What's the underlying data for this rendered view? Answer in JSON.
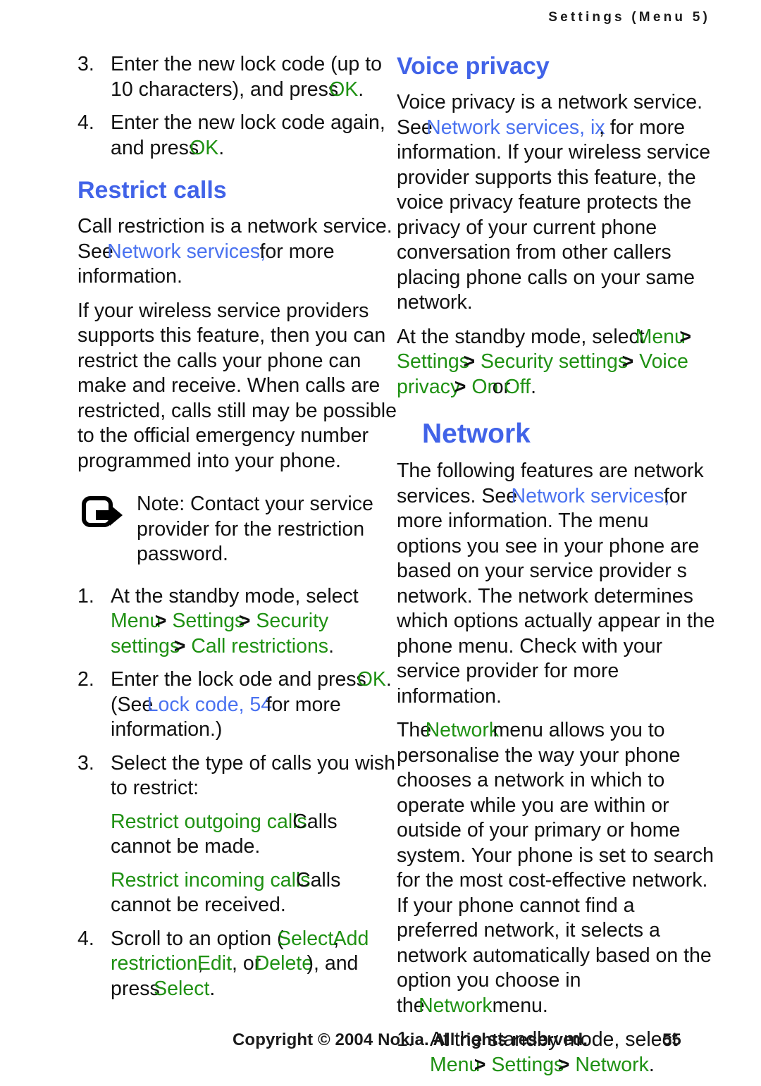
{
  "header": {
    "running_title": "Settings (Menu 5)"
  },
  "colors": {
    "heading_blue": "#4163e8",
    "link_blue": "#4a72f0",
    "ui_green": "#1f9113",
    "body_black": "#111111"
  },
  "left_column": {
    "steps_top": [
      {
        "num": "3.",
        "text_a": "Enter the new lock code (up to 10 characters), and press",
        "ui": "OK",
        "text_b": "."
      },
      {
        "num": "4.",
        "text_a": "Enter the new lock code again, and press",
        "ui": "OK",
        "text_b": "."
      }
    ],
    "heading": "Restrict calls",
    "para_1_a": "Call restriction is a network service. See",
    "para_1_link": "Network services,",
    "para_1_b": "for more information.",
    "para_2": "If your wireless service providers supports this feature, then you can restrict the calls your phone can make and receive. When calls are restricted, calls still may be possible to the official emergency number programmed into your phone.",
    "note": {
      "icon": "note-arrow-icon",
      "label": "Note:",
      "text": "Contact your service provider for the restriction password."
    },
    "steps": [
      {
        "num": "1.",
        "text_a": "At the standby mode, select",
        "menu_path": [
          "Menu",
          "Settings",
          "Security settings",
          "Call restrictions"
        ],
        "separator": ">",
        "text_b": "."
      },
      {
        "num": "2.",
        "text_a": "Enter the lock ode and press",
        "ui": "OK",
        "text_b": ". (See",
        "link": "Lock code, 54",
        "text_c": "for more information.)"
      },
      {
        "num": "3.",
        "text_a": "Select the type of calls you wish to restrict:"
      }
    ],
    "definitions": [
      {
        "term": "Restrict outgoing calls",
        "desc": "Calls cannot be made."
      },
      {
        "term": "Restrict incoming calls",
        "desc": "Calls cannot be received."
      }
    ],
    "step_4": {
      "num": "4.",
      "text_a": "Scroll to an option (",
      "ui_1": "Select",
      "text_b": ",",
      "ui_2": "Add restriction",
      "text_c": ",",
      "ui_3": "Edit",
      "text_d": ", or",
      "ui_4": "Delete",
      "text_e": "), and press",
      "ui_5": "Select",
      "text_f": "."
    }
  },
  "right_column": {
    "heading_voice": "Voice privacy",
    "voice_para_a": "Voice privacy is a network service. See",
    "voice_link": "Network services, ix",
    "voice_para_b": ", for more information. If your wireless service provider supports this feature, the voice privacy feature protects the privacy of your current phone conversation from other callers placing phone calls on your same network.",
    "voice_step_a": "At the standby mode, select",
    "voice_menu_path": [
      "Menu",
      "Settings",
      "Security settings",
      "Voice privacy"
    ],
    "voice_menu_sep": ">",
    "voice_opt_on": "On",
    "voice_opt_or": "or",
    "voice_opt_off": "Off",
    "voice_opt_end": ".",
    "heading_network": "Network",
    "net_para_1_a": "The following features are network services. See",
    "net_para_1_link": "Network services,",
    "net_para_1_b": "for more information. The menu options you see in your phone are based on your service provider s network. The network determines which options actually appear in the phone menu. Check with your service provider for more information.",
    "net_para_2_a": "The",
    "net_para_2_ui": "Network",
    "net_para_2_b": "menu allows you to personalise the way your phone chooses a network in which to operate while you are within or outside of your primary or home system. Your phone is set to search for the most cost-effective network. If your phone cannot find a preferred network, it selects a network automatically based on the option you choose in the",
    "net_para_2_ui2": "Network",
    "net_para_2_c": "menu.",
    "net_step": {
      "num": "1.",
      "text_a": "At the standby mode, select",
      "menu_path": [
        "Menu",
        "Settings",
        "Network"
      ],
      "separator": ">",
      "text_b": "."
    }
  },
  "footer": {
    "copyright": "Copyright © 2004 Nokia. All rights reserved.",
    "page_number": "55"
  }
}
